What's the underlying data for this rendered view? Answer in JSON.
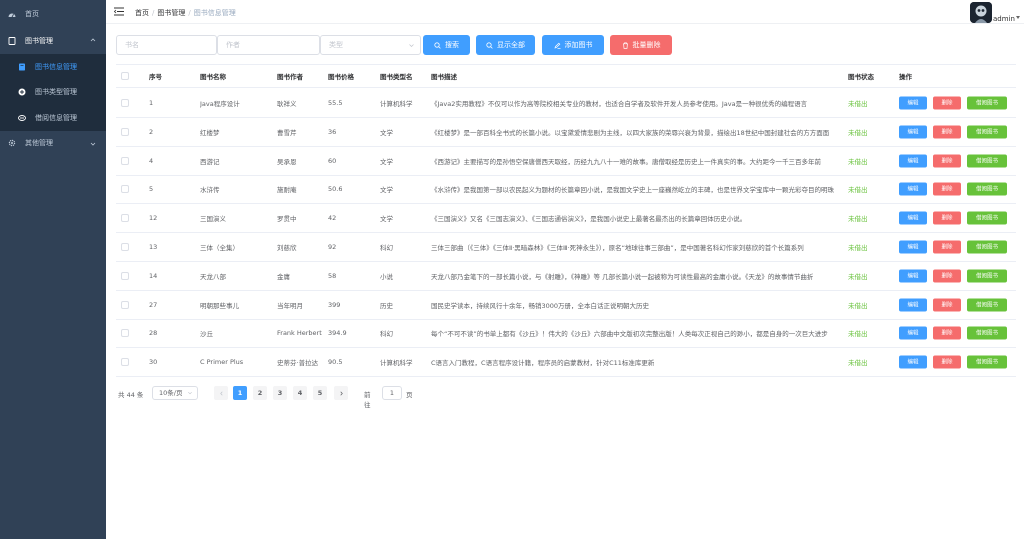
{
  "sidebar": {
    "home": "首页",
    "book_manage": "图书管理",
    "sub_items": [
      "图书信息管理",
      "图书类型管理",
      "借阅信息管理"
    ],
    "other_manage": "其他管理"
  },
  "header": {
    "breadcrumb": [
      "首页",
      "图书管理",
      "图书信息管理"
    ],
    "username": "admin"
  },
  "filters": {
    "book_name_placeholder": "书名",
    "author_placeholder": "作者",
    "type_placeholder": "类型",
    "search_label": "搜索",
    "show_all_label": "显示全部",
    "add_label": "添加图书",
    "batch_delete_label": "批量删除"
  },
  "table": {
    "headers": [
      "序号",
      "图书名称",
      "图书作者",
      "图书价格",
      "图书类型名",
      "图书描述",
      "图书状态",
      "操作"
    ],
    "edit_label": "编辑",
    "delete_label": "删除",
    "borrow_label": "借阅图书",
    "rows": [
      {
        "id": "1",
        "name": "Java程序设计",
        "author": "耿祥义",
        "price": "55.5",
        "type": "计算机科学",
        "desc": "《Java2实用教程》不仅可以作为高等院校相关专业的教材，也适合自学者及软件开发人员参考使用。Java是一种很优秀的编程语言",
        "status": "未借出"
      },
      {
        "id": "2",
        "name": "红楼梦",
        "author": "曹雪芹",
        "price": "36",
        "type": "文学",
        "desc": "《红楼梦》是一部百科全书式的长篇小说。以宝黛爱情悲剧为主线，以四大家族的荣辱兴衰为背景，描绘出18世纪中国封建社会的方方面面",
        "status": "未借出"
      },
      {
        "id": "4",
        "name": "西游记",
        "author": "吴承恩",
        "price": "60",
        "type": "文学",
        "desc": "《西游记》主要描写的是孙悟空保唐僧西天取经，历经九九八十一难的故事。唐僧取经是历史上一件真实的事。大约距今一千三百多年前",
        "status": "未借出"
      },
      {
        "id": "5",
        "name": "水浒传",
        "author": "施耐庵",
        "price": "50.6",
        "type": "文学",
        "desc": "《水浒传》是我国第一部以农民起义为题材的长篇章回小说，是我国文学史上一座巍然屹立的丰碑，也是世界文学宝库中一颗光彩夺目的明珠",
        "status": "未借出"
      },
      {
        "id": "12",
        "name": "三国演义",
        "author": "罗贯中",
        "price": "42",
        "type": "文学",
        "desc": "《三国演义》又名《三国志演义》、《三国志通俗演义》，是我国小说史上最著名最杰出的长篇章回体历史小说。",
        "status": "未借出"
      },
      {
        "id": "13",
        "name": "三体（全集）",
        "author": "刘慈欣",
        "price": "92",
        "type": "科幻",
        "desc": "三体三部曲（《三体》《三体Ⅱ·黑暗森林》《三体Ⅲ·死神永生》），原名“地球往事三部曲”，是中国著名科幻作家刘慈欣的首个长篇系列",
        "status": "未借出"
      },
      {
        "id": "14",
        "name": "天龙八部",
        "author": "金庸",
        "price": "58",
        "type": "小说",
        "desc": "天龙八部乃金笔下的一部长篇小说，与《射雕》，《神雕》等 几部长篇小说一起被称为可读性最高的金庸小说。《天龙》的故事情节曲折",
        "status": "未借出"
      },
      {
        "id": "27",
        "name": "明朝那些事儿",
        "author": "当年明月",
        "price": "399",
        "type": "历史",
        "desc": "国民史学读本，持续风行十余年，畅销3000万册，全本白话正说明朝大历史",
        "status": "未借出"
      },
      {
        "id": "28",
        "name": "沙丘",
        "author": "Frank Herbert",
        "price": "394.9",
        "type": "科幻",
        "desc": "每个“不可不读”的书单上都有《沙丘》！伟大的《沙丘》六部曲中文版初次完整出版！人类每次正视自己的渺小，都是自身的一次巨大进步",
        "status": "未借出"
      },
      {
        "id": "30",
        "name": "C Primer Plus",
        "author": "史蒂芬·普拉达",
        "price": "90.5",
        "type": "计算机科学",
        "desc": "C语言入门教程，C语言程序设计籍，程序员的启蒙教材，针对C11标准库更新",
        "status": "未借出"
      }
    ]
  },
  "pagination": {
    "total": "共 44 条",
    "page_size": "10条/页",
    "pages": [
      "1",
      "2",
      "3",
      "4",
      "5"
    ],
    "goto_label": "前往",
    "goto_value": "1",
    "page_unit": "页"
  }
}
